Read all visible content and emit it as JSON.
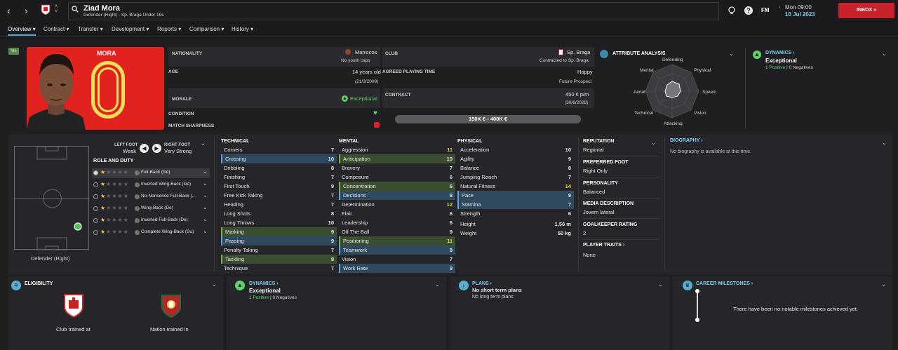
{
  "header": {
    "player_name": "Ziad Mora",
    "player_sub": "Defender (Right) - Sp. Braga Under 19s",
    "time": "Mon 09:00",
    "date": "10 Jul 2023",
    "fm_label": "FM",
    "inbox_label": "INBOX"
  },
  "menu": [
    "Overview",
    "Contract",
    "Transfer",
    "Development",
    "Reports",
    "Comparison",
    "History"
  ],
  "profile": {
    "yth_badge": "Yth",
    "shirt_name": "MORA",
    "shirt_number": "0"
  },
  "info": {
    "nationality_label": "NATIONALITY",
    "nationality": "Marrocos",
    "youth_caps": "No youth caps",
    "age_label": "AGE",
    "age": "14 years old",
    "dob": "(21/3/2009)",
    "morale_label": "MORALE",
    "morale": "Exceptional",
    "condition_label": "CONDITION",
    "sharpness_label": "MATCH SHARPNESS",
    "club_label": "CLUB",
    "club": "Sp. Braga",
    "contract_club": "Contracted to Sp. Braga",
    "playing_time_label": "AGREED PLAYING TIME",
    "playing_time": "Happy",
    "prospect": "Future Prospect",
    "contract_label": "CONTRACT",
    "wage": "450 € p/m",
    "contract_end": "(30/6/2028)",
    "value_range": "150K € - 400K €"
  },
  "attribute_analysis": {
    "title": "ATTRIBUTE ANALYSIS",
    "labels": [
      "Defending",
      "Physical",
      "Speed",
      "Vision",
      "Attacking",
      "Technical",
      "Aerial",
      "Mental"
    ]
  },
  "dynamics_top": {
    "title": "DYNAMICS",
    "value": "Exceptional",
    "positives": "1 Positive",
    "sep": " | ",
    "negatives": "0 Negatives"
  },
  "feet": {
    "left_label": "LEFT FOOT",
    "left_value": "Weak",
    "right_label": "RIGHT FOOT",
    "right_value": "Very Strong"
  },
  "roles": {
    "title": "ROLE AND DUTY",
    "items": [
      "Full-Back (De)",
      "Inverted Wing-Back (De)",
      "No-Nonsense Full-Back (...",
      "Wing-Back (De)",
      "Inverted Full-Back (De)",
      "Complete Wing-Back (Su)"
    ]
  },
  "pitch_label": "Defender (Right)",
  "technical": {
    "title": "TECHNICAL",
    "attrs": [
      {
        "name": "Corners",
        "value": "7"
      },
      {
        "name": "Crossing",
        "value": "10"
      },
      {
        "name": "Dribbling",
        "value": "8"
      },
      {
        "name": "Finishing",
        "value": "7"
      },
      {
        "name": "First Touch",
        "value": "9"
      },
      {
        "name": "Free Kick Taking",
        "value": "7"
      },
      {
        "name": "Heading",
        "value": "7"
      },
      {
        "name": "Long Shots",
        "value": "8"
      },
      {
        "name": "Long Throws",
        "value": "10"
      },
      {
        "name": "Marking",
        "value": "9"
      },
      {
        "name": "Passing",
        "value": "9"
      },
      {
        "name": "Penalty Taking",
        "value": "7"
      },
      {
        "name": "Tackling",
        "value": "9"
      },
      {
        "name": "Technique",
        "value": "7"
      }
    ]
  },
  "mental": {
    "title": "MENTAL",
    "attrs": [
      {
        "name": "Aggression",
        "value": "11"
      },
      {
        "name": "Anticipation",
        "value": "10"
      },
      {
        "name": "Bravery",
        "value": "7"
      },
      {
        "name": "Composure",
        "value": "6"
      },
      {
        "name": "Concentration",
        "value": "6"
      },
      {
        "name": "Decisions",
        "value": "8"
      },
      {
        "name": "Determination",
        "value": "12"
      },
      {
        "name": "Flair",
        "value": "6"
      },
      {
        "name": "Leadership",
        "value": "6"
      },
      {
        "name": "Off The Ball",
        "value": "9"
      },
      {
        "name": "Positioning",
        "value": "11"
      },
      {
        "name": "Teamwork",
        "value": "8"
      },
      {
        "name": "Vision",
        "value": "7"
      },
      {
        "name": "Work Rate",
        "value": "9"
      }
    ]
  },
  "physical": {
    "title": "PHYSICAL",
    "attrs": [
      {
        "name": "Acceleration",
        "value": "10"
      },
      {
        "name": "Agility",
        "value": "9"
      },
      {
        "name": "Balance",
        "value": "8"
      },
      {
        "name": "Jumping Reach",
        "value": "7"
      },
      {
        "name": "Natural Fitness",
        "value": "14"
      },
      {
        "name": "Pace",
        "value": "9"
      },
      {
        "name": "Stamina",
        "value": "7"
      },
      {
        "name": "Strength",
        "value": "6"
      }
    ],
    "height_label": "Height",
    "height": "1,56 m",
    "weight_label": "Weight",
    "weight": "50 kg"
  },
  "details": {
    "reputation_label": "REPUTATION",
    "reputation": "Regional",
    "preferred_foot_label": "PREFERRED FOOT",
    "preferred_foot": "Right Only",
    "personality_label": "PERSONALITY",
    "personality": "Balanced",
    "media_label": "MEDIA DESCRIPTION",
    "media": "Jovem lateral",
    "gk_label": "GOALKEEPER RATING",
    "gk": "2",
    "traits_label": "PLAYER TRAITS",
    "traits": "None"
  },
  "biography": {
    "title": "BIOGRAPHY",
    "text": "No biography is available at this time."
  },
  "eligibility": {
    "title": "ELIGIBILITY",
    "club_trained": "Club trained at",
    "nation_trained": "Nation trained in"
  },
  "dynamics_bottom": {
    "title": "DYNAMICS",
    "value": "Exceptional",
    "positives": "1 Positive",
    "sep": " | ",
    "negatives": "0 Negatives"
  },
  "plans": {
    "title": "PLANS",
    "short": "No short term plans",
    "long": "No long term plans"
  },
  "milestones": {
    "title": "CAREER MILESTONES",
    "text": "There have been no notable milestones achieved yet."
  },
  "colors": {
    "accent": "#58a6d8",
    "inbox": "#c8222a",
    "shirt": "#e2221f",
    "positive": "#5fd16a",
    "highlight": "#f2d541"
  }
}
